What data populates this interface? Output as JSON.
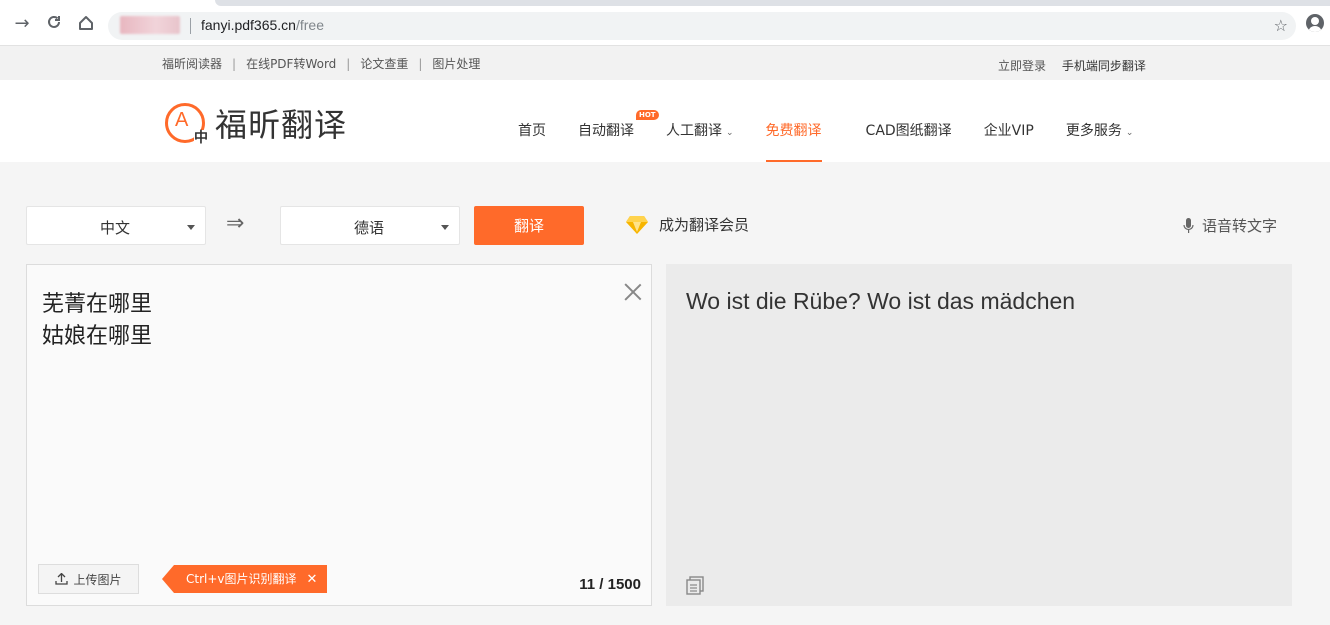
{
  "browser": {
    "url_domain": "fanyi.pdf365.cn",
    "url_path": "/free"
  },
  "toplinks": {
    "left": [
      "福昕阅读器",
      "在线PDF转Word",
      "论文查重",
      "图片处理"
    ],
    "separator": "|",
    "login": "立即登录",
    "mobile_sync": "手机端同步翻译"
  },
  "header": {
    "logo_text": "福昕翻译",
    "logo_letter": "A",
    "logo_zh": "中",
    "nav": {
      "home": "首页",
      "auto": "自动翻译",
      "hot_badge": "HOT",
      "human": "人工翻译",
      "free": "免费翻译",
      "cad": "CAD图纸翻译",
      "enterprise": "企业VIP",
      "more": "更多服务"
    }
  },
  "controls": {
    "source_lang": "中文",
    "target_lang": "德语",
    "translate_label": "翻译",
    "vip_label": "成为翻译会员",
    "voice_label": "语音转文字"
  },
  "source": {
    "text": "芜菁在哪里\n姑娘在哪里",
    "upload_label": "上传图片",
    "ocr_tip": "Ctrl+v图片识别翻译",
    "ocr_close": "✕",
    "char_count": "11 / 1500"
  },
  "target": {
    "text": "Wo ist die Rübe? Wo ist das mädchen"
  },
  "colors": {
    "accent": "#ff6a2a"
  }
}
